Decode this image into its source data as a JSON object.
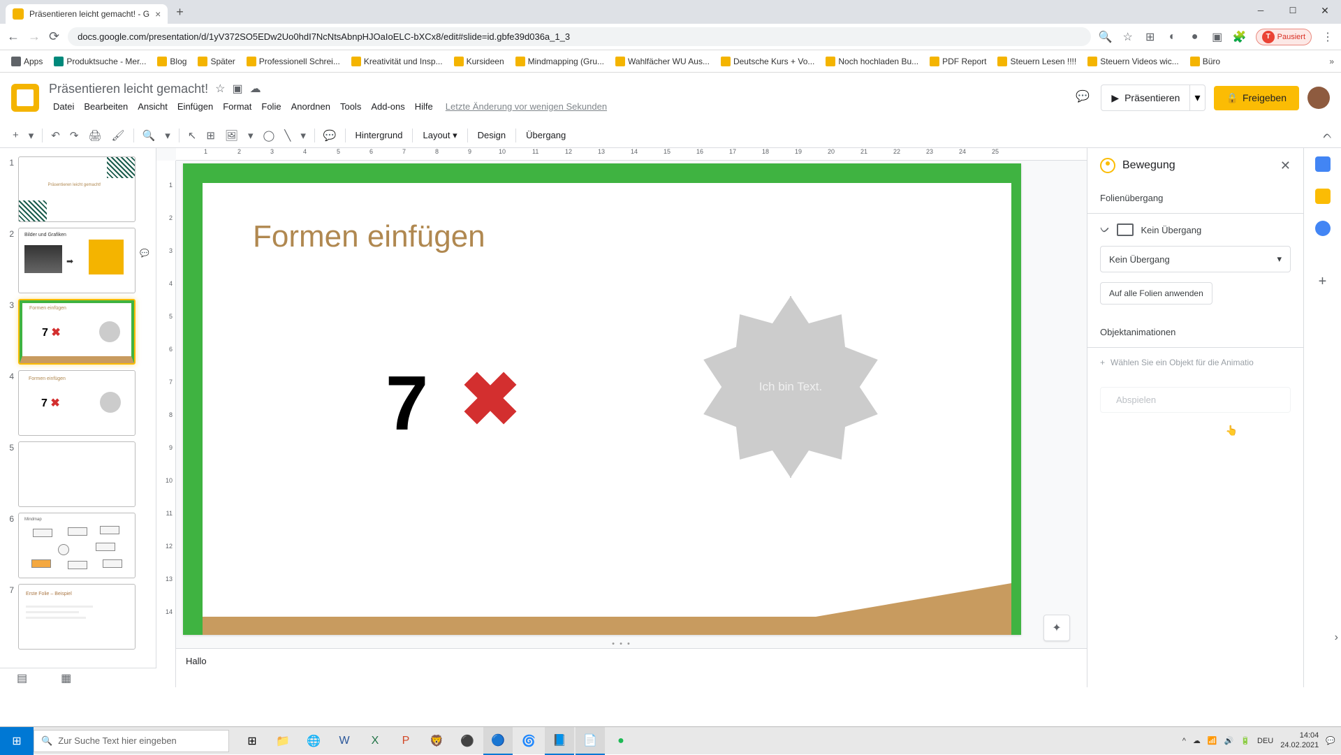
{
  "browser": {
    "tab_title": "Präsentieren leicht gemacht! - G",
    "url": "docs.google.com/presentation/d/1yV372SO5EDw2Uo0hdI7NcNtsAbnpHJOaIoELC-bXCx8/edit#slide=id.gbfe39d036a_1_3",
    "profile_status": "Pausiert"
  },
  "bookmarks": {
    "apps": "Apps",
    "items": [
      "Produktsuche - Mer...",
      "Blog",
      "Später",
      "Professionell Schrei...",
      "Kreativität und Insp...",
      "Kursideen",
      "Mindmapping (Gru...",
      "Wahlfächer WU Aus...",
      "Deutsche Kurs + Vo...",
      "Noch hochladen Bu...",
      "PDF Report",
      "Steuern Lesen !!!!",
      "Steuern Videos wic...",
      "Büro"
    ]
  },
  "app": {
    "title": "Präsentieren leicht gemacht!",
    "menus": [
      "Datei",
      "Bearbeiten",
      "Ansicht",
      "Einfügen",
      "Format",
      "Folie",
      "Anordnen",
      "Tools",
      "Add-ons",
      "Hilfe"
    ],
    "last_edit": "Letzte Änderung vor wenigen Sekunden",
    "present": "Präsentieren",
    "share": "Freigeben"
  },
  "toolbar": {
    "background": "Hintergrund",
    "layout": "Layout",
    "design": "Design",
    "transition": "Übergang"
  },
  "slide": {
    "heading": "Formen einfügen",
    "seven": "7",
    "star_text": "Ich bin Text.",
    "notes": "Hallo"
  },
  "thumbs": {
    "t1_title": "Präsentieren leicht gemacht!",
    "t2_title": "Bilder und Grafiken",
    "t3_title": "Formen einfügen",
    "t4_title": "Formen einfügen",
    "t6_title": "Mindmap",
    "t7_title": "Erste Folie – Beispiel"
  },
  "motion": {
    "title": "Bewegung",
    "section1": "Folienübergang",
    "no_transition": "Kein Übergang",
    "dropdown": "Kein Übergang",
    "apply_all": "Auf alle Folien anwenden",
    "section2": "Objektanimationen",
    "select_hint": "Wählen Sie ein Objekt für die Animatio",
    "play": "Abspielen"
  },
  "ruler_h": [
    "1",
    "2",
    "3",
    "4",
    "5",
    "6",
    "7",
    "8",
    "9",
    "10",
    "11",
    "12",
    "13",
    "14",
    "15",
    "16",
    "17",
    "18",
    "19",
    "20",
    "21",
    "22",
    "23",
    "24",
    "25"
  ],
  "ruler_v": [
    "1",
    "2",
    "3",
    "4",
    "5",
    "6",
    "7",
    "8",
    "9",
    "10",
    "11",
    "12",
    "13",
    "14"
  ],
  "taskbar": {
    "search_placeholder": "Zur Suche Text hier eingeben",
    "lang": "DEU",
    "time": "14:04",
    "date": "24.02.2021"
  }
}
